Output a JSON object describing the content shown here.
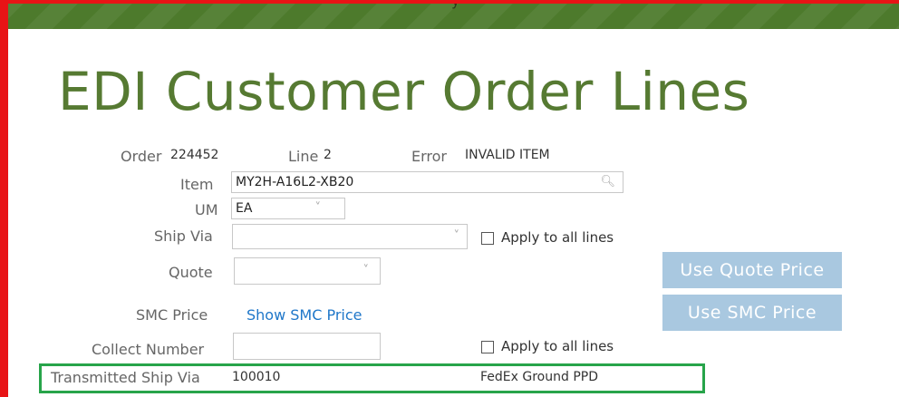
{
  "top_fragment": "y",
  "title": "EDI Customer Order Lines",
  "header": {
    "order_label": "Order",
    "order_value": "224452",
    "line_label": "Line",
    "line_value": "2",
    "error_label": "Error",
    "error_value": "INVALID ITEM"
  },
  "item": {
    "label": "Item",
    "value": "MY2H-A16L2-XB20",
    "icon": "search-icon"
  },
  "um": {
    "label": "UM",
    "value": "EA",
    "icon": "chevron-down-icon"
  },
  "ship_via": {
    "label": "Ship Via",
    "value": "",
    "icon": "chevron-down-icon",
    "apply_all_label": "Apply to all lines",
    "apply_all_checked": false
  },
  "quote": {
    "label": "Quote",
    "value": "",
    "icon": "chevron-down-icon"
  },
  "buttons": {
    "use_quote_price": "Use Quote Price",
    "use_smc_price": "Use SMC Price"
  },
  "smc_price": {
    "label": "SMC Price",
    "link": "Show SMC Price"
  },
  "collect_number": {
    "label": "Collect Number",
    "value": "",
    "apply_all_label": "Apply to all lines",
    "apply_all_checked": false
  },
  "transmitted_ship_via": {
    "label": "Transmitted Ship Via",
    "code": "100010",
    "description": "FedEx Ground PPD"
  },
  "colors": {
    "brand_green": "#567a32",
    "top_bar": "#4d7a2c",
    "button": "#a9c8e0",
    "link": "#1f77c9",
    "highlight_red": "#e81416",
    "highlight_green": "#27a44a"
  }
}
